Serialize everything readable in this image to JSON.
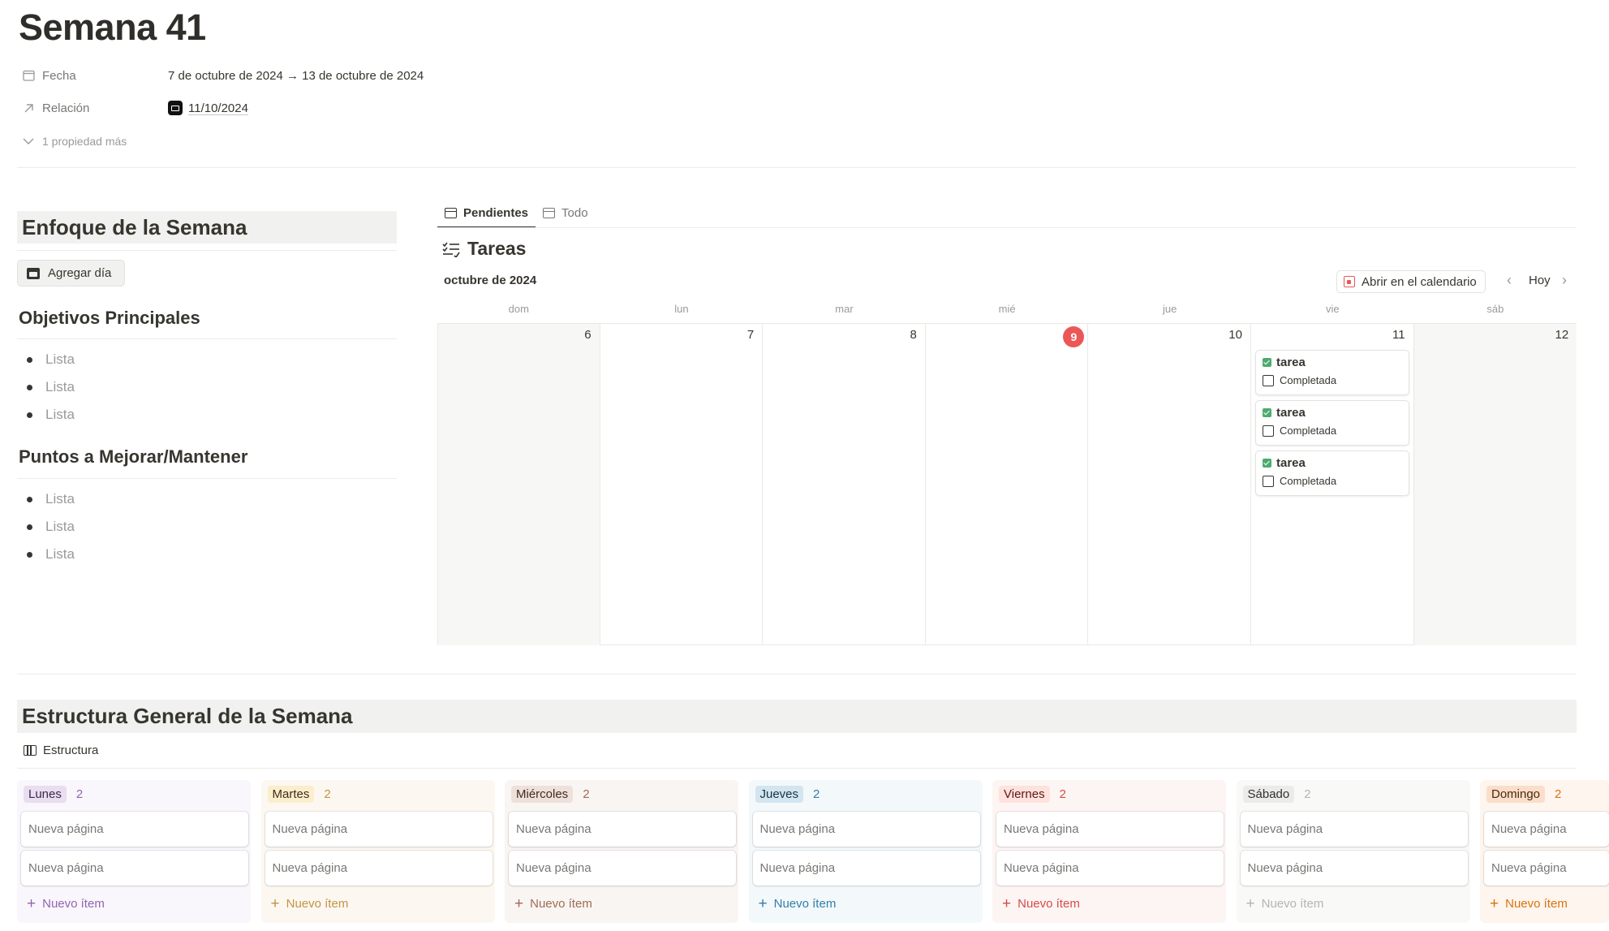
{
  "page": {
    "title": "Semana 41"
  },
  "properties": {
    "fecha": {
      "label": "Fecha",
      "value": "7 de octubre de 2024 → 13 de octubre de 2024"
    },
    "relacion": {
      "label": "Relación",
      "value": "11/10/2024"
    },
    "more": "1 propiedad más"
  },
  "left": {
    "enfoque_heading": "Enfoque de la Semana",
    "add_day_button": "Agregar día",
    "objetivos_heading": "Objetivos Principales",
    "objetivos_items": [
      "Lista",
      "Lista",
      "Lista"
    ],
    "puntos_heading": "Puntos a Mejorar/Mantener",
    "puntos_items": [
      "Lista",
      "Lista",
      "Lista"
    ]
  },
  "tasks_view": {
    "tabs": [
      {
        "label": "Pendientes",
        "active": true
      },
      {
        "label": "Todo",
        "active": false
      }
    ],
    "title": "Tareas",
    "month": "octubre de 2024",
    "open_calendar": "Abrir en el calendario",
    "today": "Hoy",
    "weekdays": [
      "dom",
      "lun",
      "mar",
      "mié",
      "jue",
      "vie",
      "sáb"
    ],
    "days": [
      "6",
      "7",
      "8",
      "9",
      "10",
      "11",
      "12"
    ],
    "today_index": 3,
    "today_color": "#eb5757",
    "tasks": [
      {
        "title": "tarea",
        "prop": "Completada"
      },
      {
        "title": "tarea",
        "prop": "Completada"
      },
      {
        "title": "tarea",
        "prop": "Completada"
      }
    ]
  },
  "board": {
    "heading": "Estructura General de la Semana",
    "view_label": "Estructura",
    "columns": [
      {
        "name": "Lunes",
        "count": "2",
        "bg": "#f9f6fc",
        "tag_bg": "#e8deee",
        "tag_fg": "#412454",
        "accent": "#9065b0",
        "cards": [
          "Nueva página",
          "Nueva página"
        ],
        "new_label": "Nuevo ítem"
      },
      {
        "name": "Martes",
        "count": "2",
        "bg": "#fcf8f1",
        "tag_bg": "#fbeecc",
        "tag_fg": "#402c1b",
        "accent": "#c29343",
        "cards": [
          "Nueva página",
          "Nueva página"
        ],
        "new_label": "Nuevo ítem"
      },
      {
        "name": "Miércoles",
        "count": "2",
        "bg": "#f9f5f3",
        "tag_bg": "#eee0da",
        "tag_fg": "#442a1e",
        "accent": "#9f6b53",
        "cards": [
          "Nueva página",
          "Nueva página"
        ],
        "new_label": "Nuevo ítem"
      },
      {
        "name": "Jueves",
        "count": "2",
        "bg": "#f3f8fb",
        "tag_bg": "#d3e5ef",
        "tag_fg": "#183347",
        "accent": "#337ea9",
        "cards": [
          "Nueva página",
          "Nueva página"
        ],
        "new_label": "Nuevo ítem"
      },
      {
        "name": "Viernes",
        "count": "2",
        "bg": "#fdf5f3",
        "tag_bg": "#ffe2dd",
        "tag_fg": "#5d1715",
        "accent": "#d44c47",
        "cards": [
          "Nueva página",
          "Nueva página"
        ],
        "new_label": "Nuevo ítem"
      },
      {
        "name": "Sábado",
        "count": "2",
        "bg": "#f9f9f8",
        "tag_bg": "#ebebea",
        "tag_fg": "#32302c",
        "accent": "#b4b4b0",
        "cards": [
          "Nueva página",
          "Nueva página"
        ],
        "new_label": "Nuevo ítem"
      },
      {
        "name": "Domingo",
        "count": "2",
        "bg": "#fdf5ee",
        "tag_bg": "#fadec9",
        "tag_fg": "#49290e",
        "accent": "#d9730d",
        "cards": [
          "Nueva página",
          "Nueva página"
        ],
        "new_label": "Nuevo ítem"
      }
    ]
  }
}
